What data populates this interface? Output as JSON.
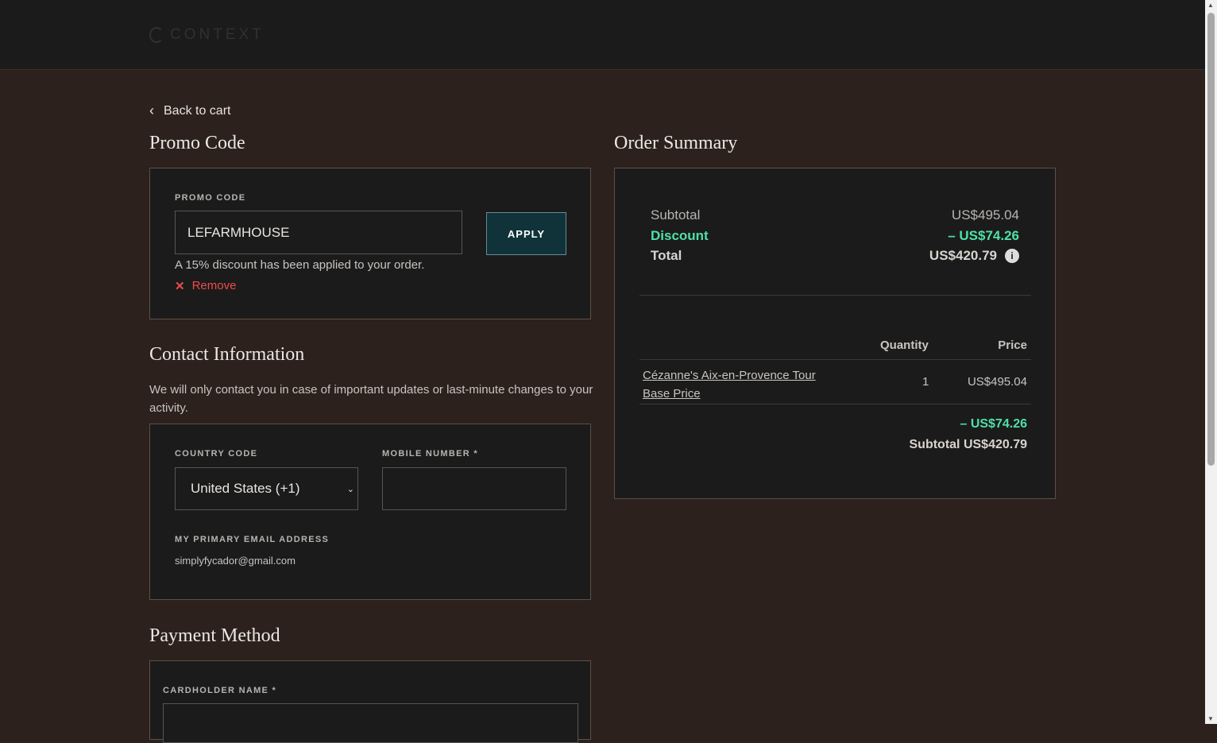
{
  "header": {
    "logo_text": "CONTEXT"
  },
  "back_link": "Back to cart",
  "promo": {
    "title": "Promo Code",
    "label": "PROMO CODE",
    "value": "LEFARMHOUSE",
    "apply": "APPLY",
    "message": "A 15% discount has been applied to your order.",
    "remove": "Remove"
  },
  "contact": {
    "title": "Contact Information",
    "description": "We will only contact you in case of important updates or last-minute changes to your activity.",
    "country_label": "COUNTRY CODE",
    "country_value": "United States (+1)",
    "mobile_label": "MOBILE NUMBER *",
    "mobile_value": "",
    "email_label": "MY PRIMARY EMAIL ADDRESS",
    "email_value": "simplyfycador@gmail.com"
  },
  "payment": {
    "title": "Payment Method",
    "cardholder_label": "CARDHOLDER NAME *"
  },
  "summary": {
    "title": "Order Summary",
    "subtotal_label": "Subtotal",
    "subtotal_value": "US$495.04",
    "discount_label": "Discount",
    "discount_value": "– US$74.26",
    "total_label": "Total",
    "total_value": "US$420.79",
    "col_quantity": "Quantity",
    "col_price": "Price",
    "item_name": "Cézanne's Aix-en-Provence Tour",
    "item_variant": "Base Price",
    "item_qty": "1",
    "item_price": "US$495.04",
    "item_discount": "– US$74.26",
    "item_subtotal": "Subtotal US$420.79",
    "accent": "#4ee0a8"
  }
}
